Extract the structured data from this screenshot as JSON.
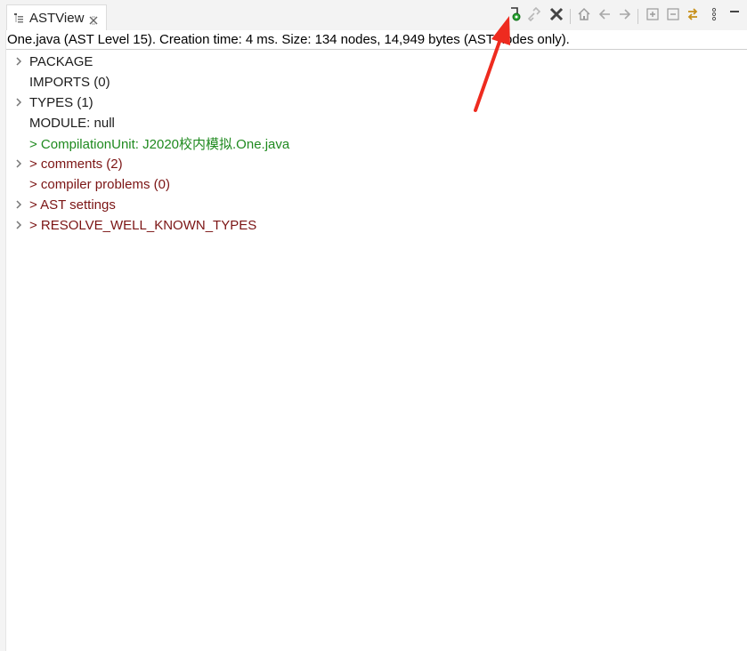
{
  "tab": {
    "title": "ASTView",
    "icon": "tree-view-icon"
  },
  "toolbar": {
    "buttons": [
      {
        "name": "open-ast-button",
        "icon": "ast-open-green-icon"
      },
      {
        "name": "link-button",
        "icon": "link-icon"
      },
      {
        "name": "clear-button",
        "icon": "close-x-icon"
      },
      {
        "name": "home-button",
        "icon": "home-icon"
      },
      {
        "name": "back-button",
        "icon": "arrow-left-icon"
      },
      {
        "name": "forward-button",
        "icon": "arrow-right-icon"
      },
      {
        "name": "expand-all-button",
        "icon": "expand-all-icon"
      },
      {
        "name": "collapse-all-button",
        "icon": "collapse-all-icon"
      },
      {
        "name": "refresh-button",
        "icon": "refresh-arrows-icon"
      },
      {
        "name": "view-menu-button",
        "icon": "vertical-dots-icon"
      }
    ]
  },
  "status": {
    "text": "One.java (AST Level 15).  Creation time: 4 ms.  Size: 134 nodes, 14,949 bytes (AST nodes only)."
  },
  "tree": {
    "items": [
      {
        "label": "PACKAGE",
        "expandable": true,
        "color": "#1b1b1b"
      },
      {
        "label": "IMPORTS (0)",
        "expandable": false,
        "color": "#1b1b1b"
      },
      {
        "label": "TYPES (1)",
        "expandable": true,
        "color": "#1b1b1b"
      },
      {
        "label": "MODULE: null",
        "expandable": false,
        "color": "#1b1b1b"
      },
      {
        "label": "> CompilationUnit: J2020校内模拟.One.java",
        "expandable": false,
        "color": "#1f8a1f"
      },
      {
        "label": "> comments (2)",
        "expandable": true,
        "color": "#7b1414"
      },
      {
        "label": "> compiler problems (0)",
        "expandable": false,
        "color": "#7b1414"
      },
      {
        "label": "> AST settings",
        "expandable": true,
        "color": "#7b1414"
      },
      {
        "label": "> RESOLVE_WELL_KNOWN_TYPES",
        "expandable": true,
        "color": "#7b1414"
      }
    ]
  },
  "colors": {
    "annotation_arrow": "#ee2b1f",
    "green": "#1f8a1f",
    "maroon": "#7b1414"
  }
}
